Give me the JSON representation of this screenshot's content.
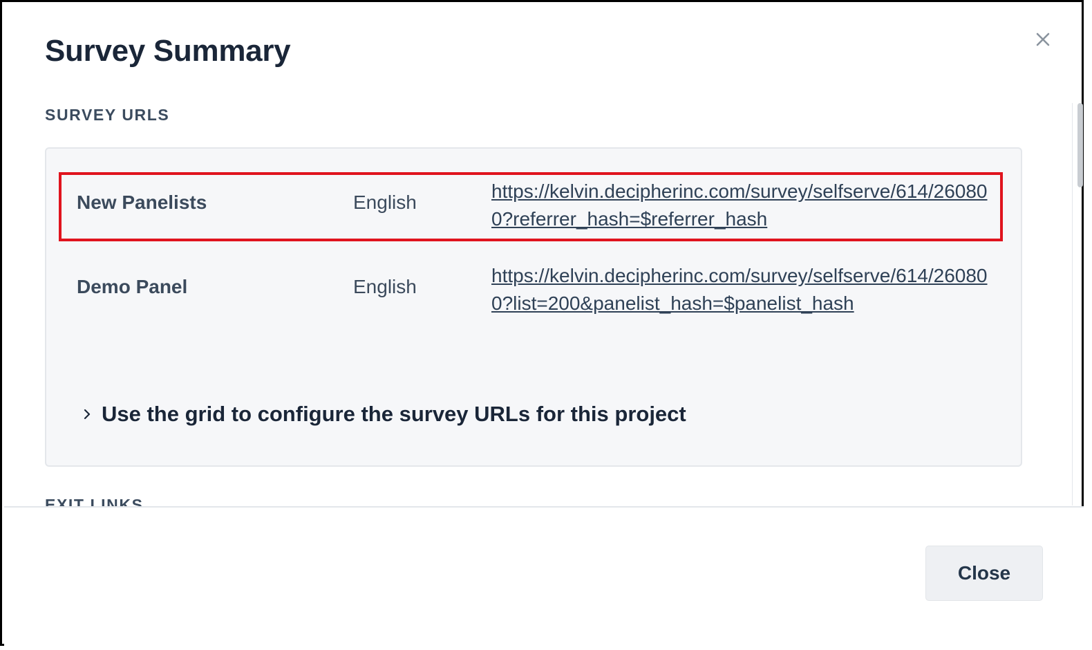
{
  "dialog": {
    "title": "Survey Summary",
    "close_icon": "close-icon"
  },
  "survey_urls": {
    "section_label": "SURVEY URLS",
    "rows": [
      {
        "name": "New Panelists",
        "language": "English",
        "url": "https://kelvin.decipherinc.com/survey/selfserve/614/260800?referrer_hash=$referrer_hash",
        "highlighted": true
      },
      {
        "name": "Demo Panel",
        "language": "English",
        "url": "https://kelvin.decipherinc.com/survey/selfserve/614/260800?list=200&panelist_hash=$panelist_hash",
        "highlighted": false
      }
    ],
    "expander_label": "Use the grid to configure the survey URLs for this project",
    "expander_icon": "chevron-right-icon"
  },
  "next_section_label": "EXIT LINKS",
  "footer": {
    "close_label": "Close"
  },
  "colors": {
    "highlight": "#e0141e",
    "panel_bg": "#f6f7f9",
    "text_dark": "#1a2638"
  }
}
